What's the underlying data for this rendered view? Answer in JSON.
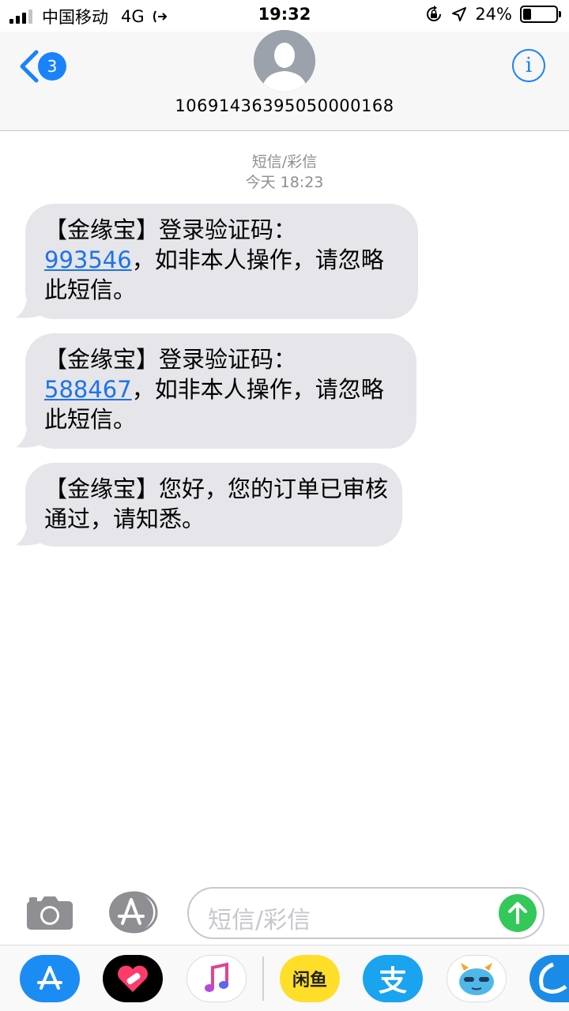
{
  "status_bar": {
    "carrier": "中国移动",
    "network": "4G",
    "time": "19:32",
    "battery_percent_text": "24%",
    "battery_level": 0.24
  },
  "header": {
    "back_count": "3",
    "contact_number": "10691436395050000168",
    "info_glyph": "i"
  },
  "conversation": {
    "service_label": "短信/彩信",
    "timestamp": "今天 18:23",
    "messages": [
      {
        "before": "【金缘宝】登录验证码：",
        "code": "993546",
        "after": "，如非本人操作，请忽略此短信。"
      },
      {
        "before": "【金缘宝】登录验证码：",
        "code": "588467",
        "after": "，如非本人操作，请忽略此短信。"
      },
      {
        "before": "【金缘宝】您好，您的订单已审核通过，请知悉。",
        "code": "",
        "after": ""
      }
    ]
  },
  "compose": {
    "placeholder": "短信/彩信"
  },
  "app_drawer": {
    "apps": [
      "app-store-icon",
      "health-heart-app-icon",
      "music-app-icon",
      "xianyu-app-icon",
      "alipay-app-icon",
      "blue-monster-sticker-icon",
      "partial-app-icon"
    ],
    "xianyu_label": "闲鱼",
    "alipay_label": "支"
  },
  "colors": {
    "accent": "#1a82fb",
    "bubble": "#e5e5ea",
    "send": "#34c759"
  }
}
